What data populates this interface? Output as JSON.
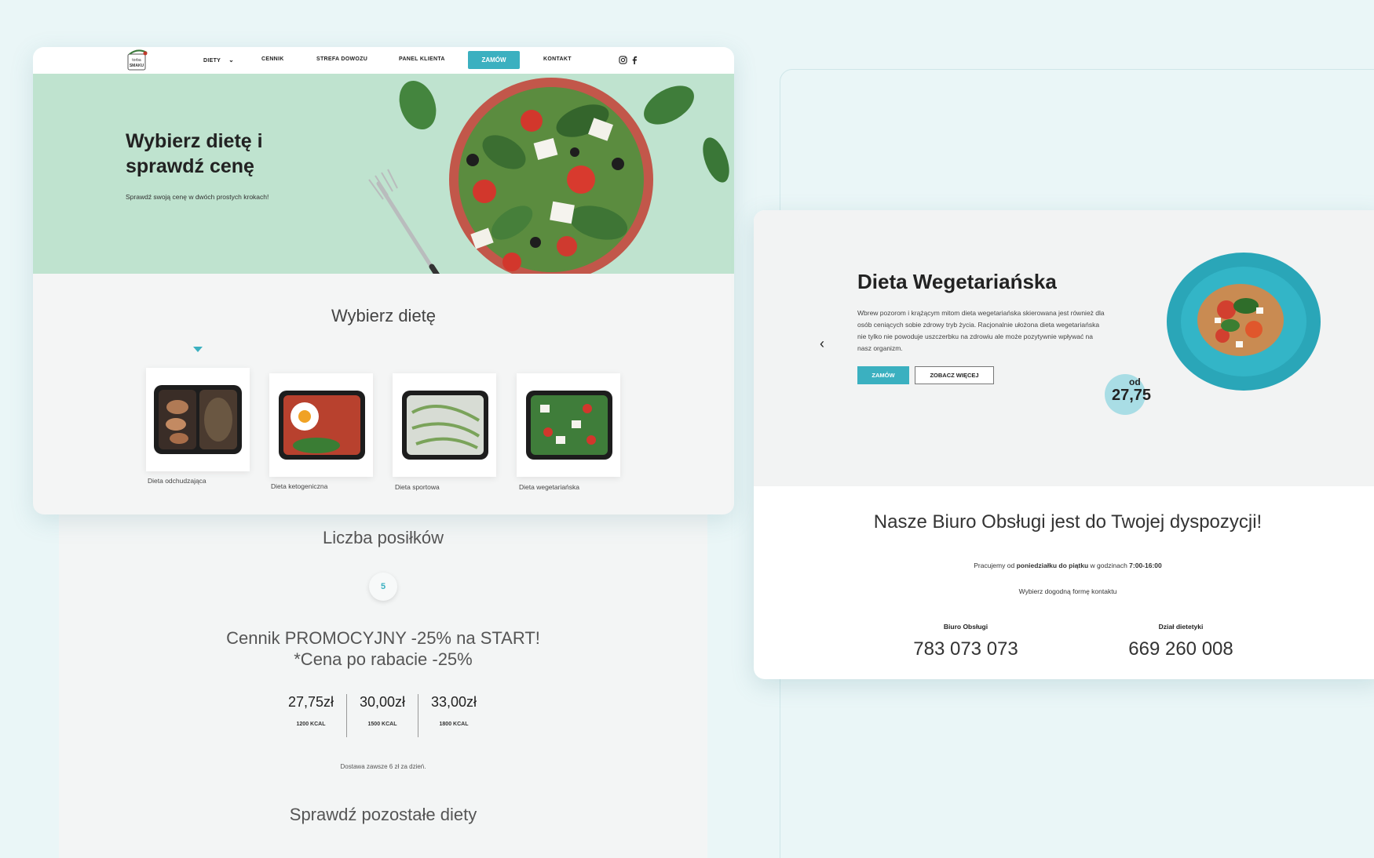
{
  "nav": {
    "items": [
      "DIETY",
      "CENNIK",
      "STREFA DOWOZU",
      "PANEL KLIENTA",
      "KONTAKT"
    ],
    "cta": "ZAMÓW"
  },
  "hero": {
    "title": "Wybierz dietę i sprawdź cenę",
    "subtitle": "Sprawdź swoją cenę w dwóch prostych krokach!"
  },
  "choose": {
    "title": "Wybierz dietę",
    "diets": [
      "Dieta odchudzająca",
      "Dieta ketogeniczna",
      "Dieta sportowa",
      "Dieta wegetariańska"
    ]
  },
  "meals": {
    "title": "Liczba posiłków",
    "count": "5"
  },
  "pricing": {
    "promo_line1": "Cennik PROMOCYJNY -25% na START!",
    "promo_line2": "*Cena po rabacie -25%",
    "plans": [
      {
        "price": "27,75zł",
        "kcal": "1200 KCAL"
      },
      {
        "price": "30,00zł",
        "kcal": "1500 KCAL"
      },
      {
        "price": "33,00zł",
        "kcal": "1800 KCAL"
      }
    ],
    "delivery": "Dostawa zawsze 6 zł za dzień."
  },
  "other": {
    "title": "Sprawdź pozostałe diety"
  },
  "diet_detail": {
    "title": "Dieta Wegetariańska",
    "description": "Wbrew pozorom i krążącym mitom dieta wegetariańska skierowana jest również dla osób ceniących sobie zdrowy tryb życia. Racjonalnie ułożona dieta wegetariańska nie tylko nie powoduje uszczerbku na zdrowiu ale może pozytywnie wpływać na nasz organizm.",
    "order_button": "ZAMÓW",
    "more_button": "ZOBACZ WIĘCEJ",
    "price_prefix": "od",
    "price": "27,75"
  },
  "contact": {
    "title": "Nasze Biuro Obsługi jest do Twojej dyspozycji!",
    "hours_pre": "Pracujemy od ",
    "hours_days": "poniedziałku do piątku",
    "hours_mid": " w godzinach ",
    "hours_time": "7:00-16:00",
    "choose": "Wybierz dogodną formę kontaktu",
    "office_label": "Biuro Obsługi",
    "office_phone": "783 073 073",
    "diet_label": "Dział dietetyki",
    "diet_phone": "669 260 008"
  },
  "colors": {
    "accent": "#3bb0c0",
    "hero_bg": "#bfe3cf",
    "page_bg": "#eaf6f7"
  }
}
